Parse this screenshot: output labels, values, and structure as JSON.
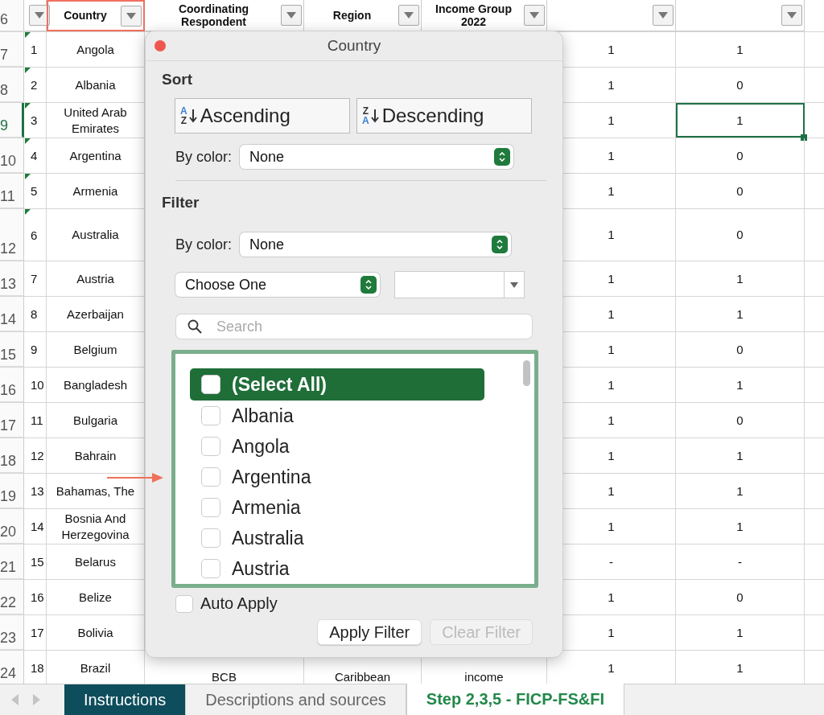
{
  "sheet": {
    "header_row_number": "6",
    "columns": [
      {
        "filter": true,
        "selected": false
      },
      {
        "label": "Country",
        "filter": true,
        "selected": true
      },
      {
        "label": "Coordinating Respondent",
        "filter": true,
        "selected": false
      },
      {
        "label": "Region",
        "filter": true,
        "selected": false
      },
      {
        "label": "Income Group 2022",
        "filter": true,
        "selected": false
      },
      {
        "filter": true,
        "selected": false
      },
      {
        "filter": true,
        "selected": false
      }
    ],
    "rows": [
      {
        "row": "7",
        "no": "1",
        "country": "Angola",
        "col_f": "1",
        "col_g": "1",
        "flag": true,
        "selected": false
      },
      {
        "row": "8",
        "no": "2",
        "country": "Albania",
        "col_f": "1",
        "col_g": "0",
        "flag": true,
        "selected": false
      },
      {
        "row": "9",
        "no": "3",
        "country": "United Arab Emirates",
        "col_f": "1",
        "col_g": "1",
        "flag": true,
        "selected": true
      },
      {
        "row": "10",
        "no": "4",
        "country": "Argentina",
        "col_f": "1",
        "col_g": "0",
        "flag": true,
        "selected": false
      },
      {
        "row": "11",
        "no": "5",
        "country": "Armenia",
        "col_f": "1",
        "col_g": "0",
        "flag": true,
        "selected": false
      },
      {
        "row": "12",
        "no": "6",
        "country": "Australia",
        "col_f": "1",
        "col_g": "0",
        "flag": true,
        "selected": false,
        "tall": true
      },
      {
        "row": "13",
        "no": "7",
        "country": "Austria",
        "col_f": "1",
        "col_g": "1",
        "flag": false,
        "selected": false
      },
      {
        "row": "14",
        "no": "8",
        "country": "Azerbaijan",
        "col_f": "1",
        "col_g": "1",
        "flag": false,
        "selected": false
      },
      {
        "row": "15",
        "no": "9",
        "country": "Belgium",
        "col_f": "1",
        "col_g": "0",
        "flag": false,
        "selected": false
      },
      {
        "row": "16",
        "no": "10",
        "country": "Bangladesh",
        "col_f": "1",
        "col_g": "1",
        "flag": false,
        "selected": false
      },
      {
        "row": "17",
        "no": "11",
        "country": "Bulgaria",
        "col_f": "1",
        "col_g": "0",
        "flag": false,
        "selected": false
      },
      {
        "row": "18",
        "no": "12",
        "country": "Bahrain",
        "col_f": "1",
        "col_g": "1",
        "flag": false,
        "selected": false
      },
      {
        "row": "19",
        "no": "13",
        "country": "Bahamas, The",
        "col_f": "1",
        "col_g": "1",
        "flag": false,
        "selected": false
      },
      {
        "row": "20",
        "no": "14",
        "country": "Bosnia And Herzegovina",
        "col_f": "1",
        "col_g": "1",
        "flag": false,
        "selected": false
      },
      {
        "row": "21",
        "no": "15",
        "country": "Belarus",
        "col_f": "-",
        "col_g": "-",
        "flag": false,
        "selected": false
      },
      {
        "row": "22",
        "no": "16",
        "country": "Belize",
        "col_f": "1",
        "col_g": "0",
        "flag": false,
        "selected": false
      },
      {
        "row": "23",
        "no": "17",
        "country": "Bolivia",
        "col_f": "1",
        "col_g": "1",
        "flag": false,
        "selected": false
      },
      {
        "row": "24",
        "no": "18",
        "country": "Brazil",
        "respondent": "BCB",
        "region": "Caribbean",
        "income_group": "income",
        "col_f": "1",
        "col_g": "1",
        "flag": false,
        "selected": false
      }
    ]
  },
  "filter_dialog": {
    "title": "Country",
    "sort": {
      "heading": "Sort",
      "buttons": [
        {
          "kind": "ascending",
          "label": "Ascending",
          "icon_letters": [
            "A",
            "Z"
          ]
        },
        {
          "kind": "descending",
          "label": "Descending",
          "icon_letters": [
            "Z",
            "A"
          ]
        }
      ],
      "by_color_label": "By color:",
      "by_color_value": "None"
    },
    "filter": {
      "heading": "Filter",
      "by_color_label": "By color:",
      "by_color_value": "None",
      "condition": "Choose One",
      "search_placeholder": "Search",
      "items": [
        {
          "label": "(Select All)",
          "checked": false,
          "selected": true
        },
        {
          "label": "Albania",
          "checked": false,
          "selected": false
        },
        {
          "label": "Angola",
          "checked": false,
          "selected": false
        },
        {
          "label": "Argentina",
          "checked": false,
          "selected": false
        },
        {
          "label": "Armenia",
          "checked": false,
          "selected": false
        },
        {
          "label": "Australia",
          "checked": false,
          "selected": false
        },
        {
          "label": "Austria",
          "checked": false,
          "selected": false
        }
      ]
    },
    "auto_apply": {
      "label": "Auto Apply",
      "checked": false
    },
    "buttons": [
      {
        "label": "Apply Filter",
        "disabled": false
      },
      {
        "label": "Clear Filter",
        "disabled": true
      }
    ]
  },
  "sheet_tabs": [
    {
      "label": "Instructions",
      "selected": false,
      "color": "#0e4d5c"
    },
    {
      "label": "Descriptions and sources",
      "selected": false
    },
    {
      "label": "Step 2,3,5 - FICP-FS&FI",
      "selected": true
    }
  ]
}
